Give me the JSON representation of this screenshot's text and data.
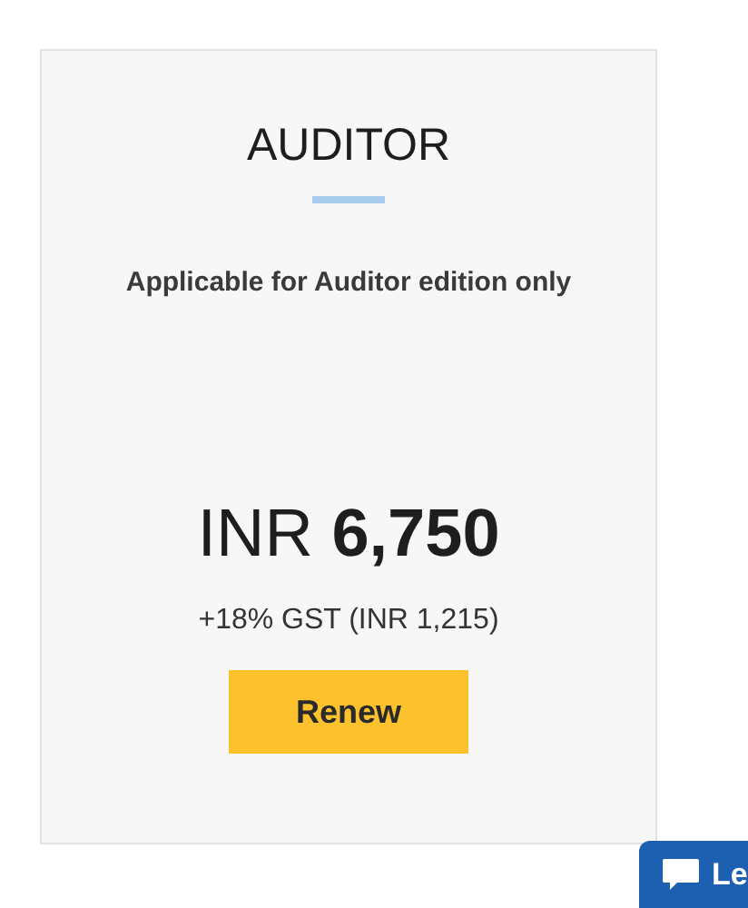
{
  "plan": {
    "title": "AUDITOR",
    "subtitle": "Applicable for Auditor edition only",
    "price": "INR **6,750**",
    "tax": "+18% GST (INR 1,215)",
    "button": "Renew"
  },
  "chat_widget": {
    "label": "Le"
  }
}
